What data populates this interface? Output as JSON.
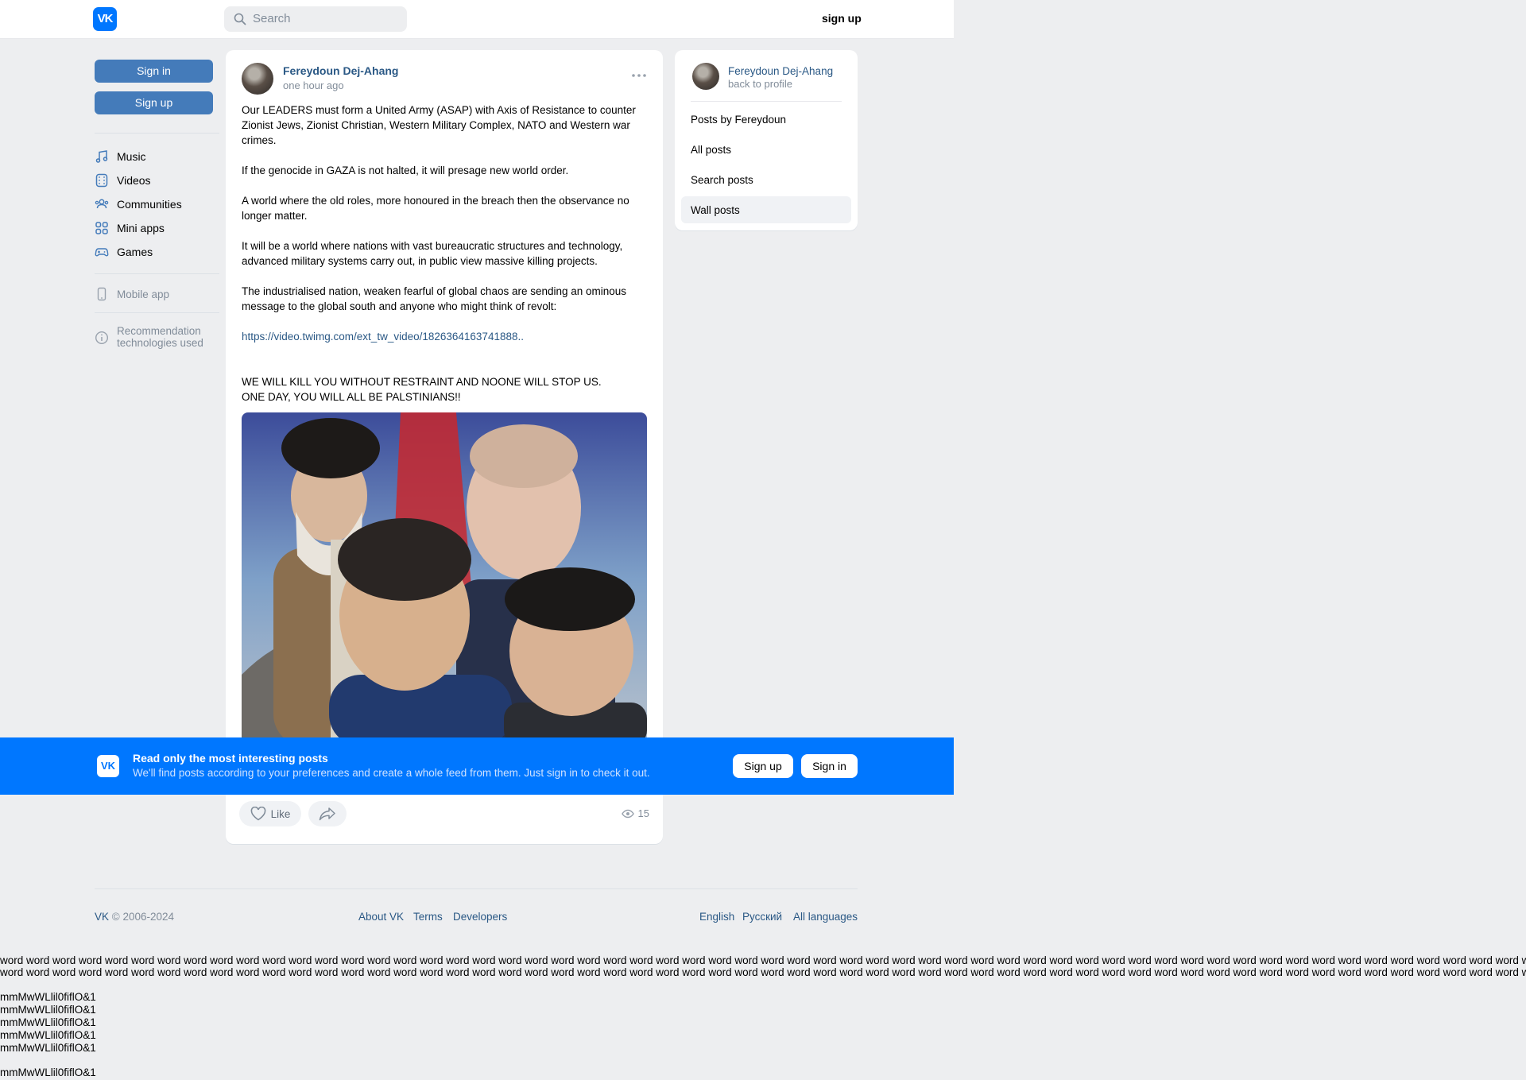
{
  "header": {
    "logo_text": "VK",
    "search_placeholder": "Search",
    "signup_link": "sign up"
  },
  "sidebar": {
    "sign_in": "Sign in",
    "sign_up": "Sign up",
    "nav": [
      "Music",
      "Videos",
      "Communities",
      "Mini apps",
      "Games"
    ],
    "mobile_app": "Mobile app",
    "recommendation_1": "Recommendation",
    "recommendation_2": "technologies used"
  },
  "post": {
    "author": "Fereydoun Dej-Ahang",
    "time": "one hour ago",
    "p1": "Our LEADERS must form a United Army (ASAP) with Axis of Resistance to counter Zionist Jews, Zionist Christian, Western Military Complex, NATO and Western war crimes.",
    "p2": "If the genocide in GAZA is not halted, it will presage new world order.",
    "p3": "A world where the old roles, more honoured in the breach then the observance no longer matter.",
    "p4": "It will be a world where nations with vast bureaucratic structures and technology, advanced military systems carry out, in public view massive killing projects.",
    "p5": "The industrialised nation, weaken fearful of global chaos are sending an ominous message to the global south and anyone who might think of revolt:",
    "link": "https://video.twimg.com/ext_tw_video/1826364163741888..",
    "p6a": "WE WILL KILL YOU WITHOUT RESTRAINT AND NOONE WILL STOP US.",
    "p6b": "ONE DAY, YOU WILL ALL BE PALSTINIANS!!",
    "like_label": "Like",
    "views": "15"
  },
  "right_panel": {
    "name": "Fereydoun Dej-Ahang",
    "back": "back to profile",
    "items": [
      "Posts by Fereydoun",
      "All posts",
      "Search posts",
      "Wall posts"
    ]
  },
  "banner": {
    "logo_text": "VK",
    "title": "Read only the most interesting posts",
    "subtitle": "We'll find posts according to your preferences and create a whole feed from them. Just sign in to check it out.",
    "sign_up": "Sign up",
    "sign_in": "Sign in"
  },
  "footer": {
    "copyright": "VK © 2006-2024",
    "about": "About VK",
    "terms": "Terms",
    "developers": "Developers",
    "english": "English",
    "russian": "Русский",
    "all_languages": "All languages"
  },
  "overflow": {
    "word_line": "word word word word word word word word word word word word word word word word word word word word word word word word word word word word word word word word word word word word word word word word word word word word word word word word word word word word word word word word word word word word word word word word word word word word word word word word word word",
    "mm_line": "mmMwWLlil0fiflO&1"
  },
  "colors": {
    "vk_blue": "#0077ff",
    "button_blue": "#447bba",
    "link_blue": "#2a5885",
    "background": "#edeef0"
  }
}
